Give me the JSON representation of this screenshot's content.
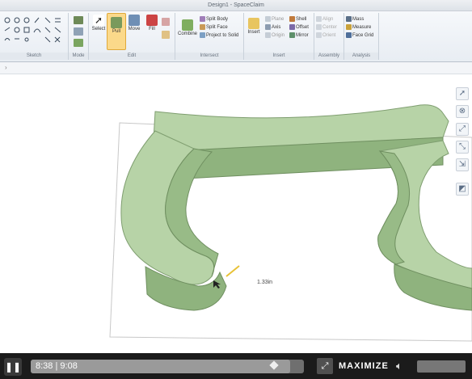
{
  "window": {
    "title": "Design1 - SpaceClaim"
  },
  "ribbon": {
    "groups": [
      {
        "label": "Sketch"
      },
      {
        "label": "Mode"
      },
      {
        "label": "Edit"
      },
      {
        "label": "Intersect"
      },
      {
        "label": "Insert"
      },
      {
        "label": "Assembly"
      },
      {
        "label": "Analysis"
      }
    ],
    "edit": {
      "select": "Select",
      "pull": "Pull",
      "move": "Move",
      "fill": "Fill"
    },
    "intersect": {
      "combine": "Combine",
      "split_body": "Split Body",
      "split_face": "Split Face",
      "project": "Project to Solid"
    },
    "insert": {
      "insert": "Insert",
      "plane": "Plane",
      "axis": "Axis",
      "origin": "Origin",
      "shell": "Shell",
      "offset": "Offset",
      "mirror": "Mirror"
    },
    "assembly": {
      "align": "Align",
      "center": "Center",
      "orient": "Orient"
    },
    "analysis": {
      "mass": "Mass",
      "measure": "Measure",
      "face_grid": "Face Grid"
    }
  },
  "canvas": {
    "dimension_label": "1.33in",
    "model_color": "#a9c99a"
  },
  "player": {
    "current_time": "8:38",
    "separator": "|",
    "total_time": "9:08",
    "progress": 0.95,
    "maximize_label": "MAXIMIZE"
  },
  "icons": {
    "play_pause": "pause-icon",
    "maximize": "maximize-icon",
    "volume": "speaker-icon"
  }
}
